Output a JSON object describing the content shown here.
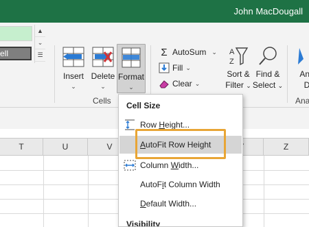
{
  "titlebar": {
    "username": "John MacDougall",
    "color": "#1e7245"
  },
  "styles_gallery": {
    "dark_cell_label": "ell"
  },
  "cells_group": {
    "label": "Cells",
    "insert": {
      "label": "Insert"
    },
    "delete": {
      "label": "Delete"
    },
    "format": {
      "label": "Format"
    }
  },
  "editing_group": {
    "autosum": "AutoSum",
    "fill": "Fill",
    "clear": "Clear",
    "sort_filter": {
      "line1": "Sort &",
      "line2": "Filter"
    },
    "find_select": {
      "line1": "Find &",
      "line2": "Select"
    },
    "label_partial": "Ana",
    "ana_btn_line1": "Ana",
    "ana_btn_line2": "D"
  },
  "columns": [
    "T",
    "U",
    "V",
    "Y",
    "Z"
  ],
  "menu": {
    "cell_size_header": "Cell Size",
    "items": [
      {
        "pre": "Row ",
        "ul": "H",
        "post": "eight...",
        "icon": "row-height-icon"
      },
      {
        "pre": "",
        "ul": "A",
        "post": "utoFit Row Height",
        "icon": "none"
      },
      {
        "pre": "Column ",
        "ul": "W",
        "post": "idth...",
        "icon": "column-width-icon"
      },
      {
        "pre": "AutoF",
        "ul": "i",
        "post": "t Column Width",
        "icon": "none"
      },
      {
        "pre": "",
        "ul": "D",
        "post": "efault Width...",
        "icon": "none"
      }
    ],
    "visibility_header": "Visibility",
    "highlight_color": "#e8a535"
  }
}
